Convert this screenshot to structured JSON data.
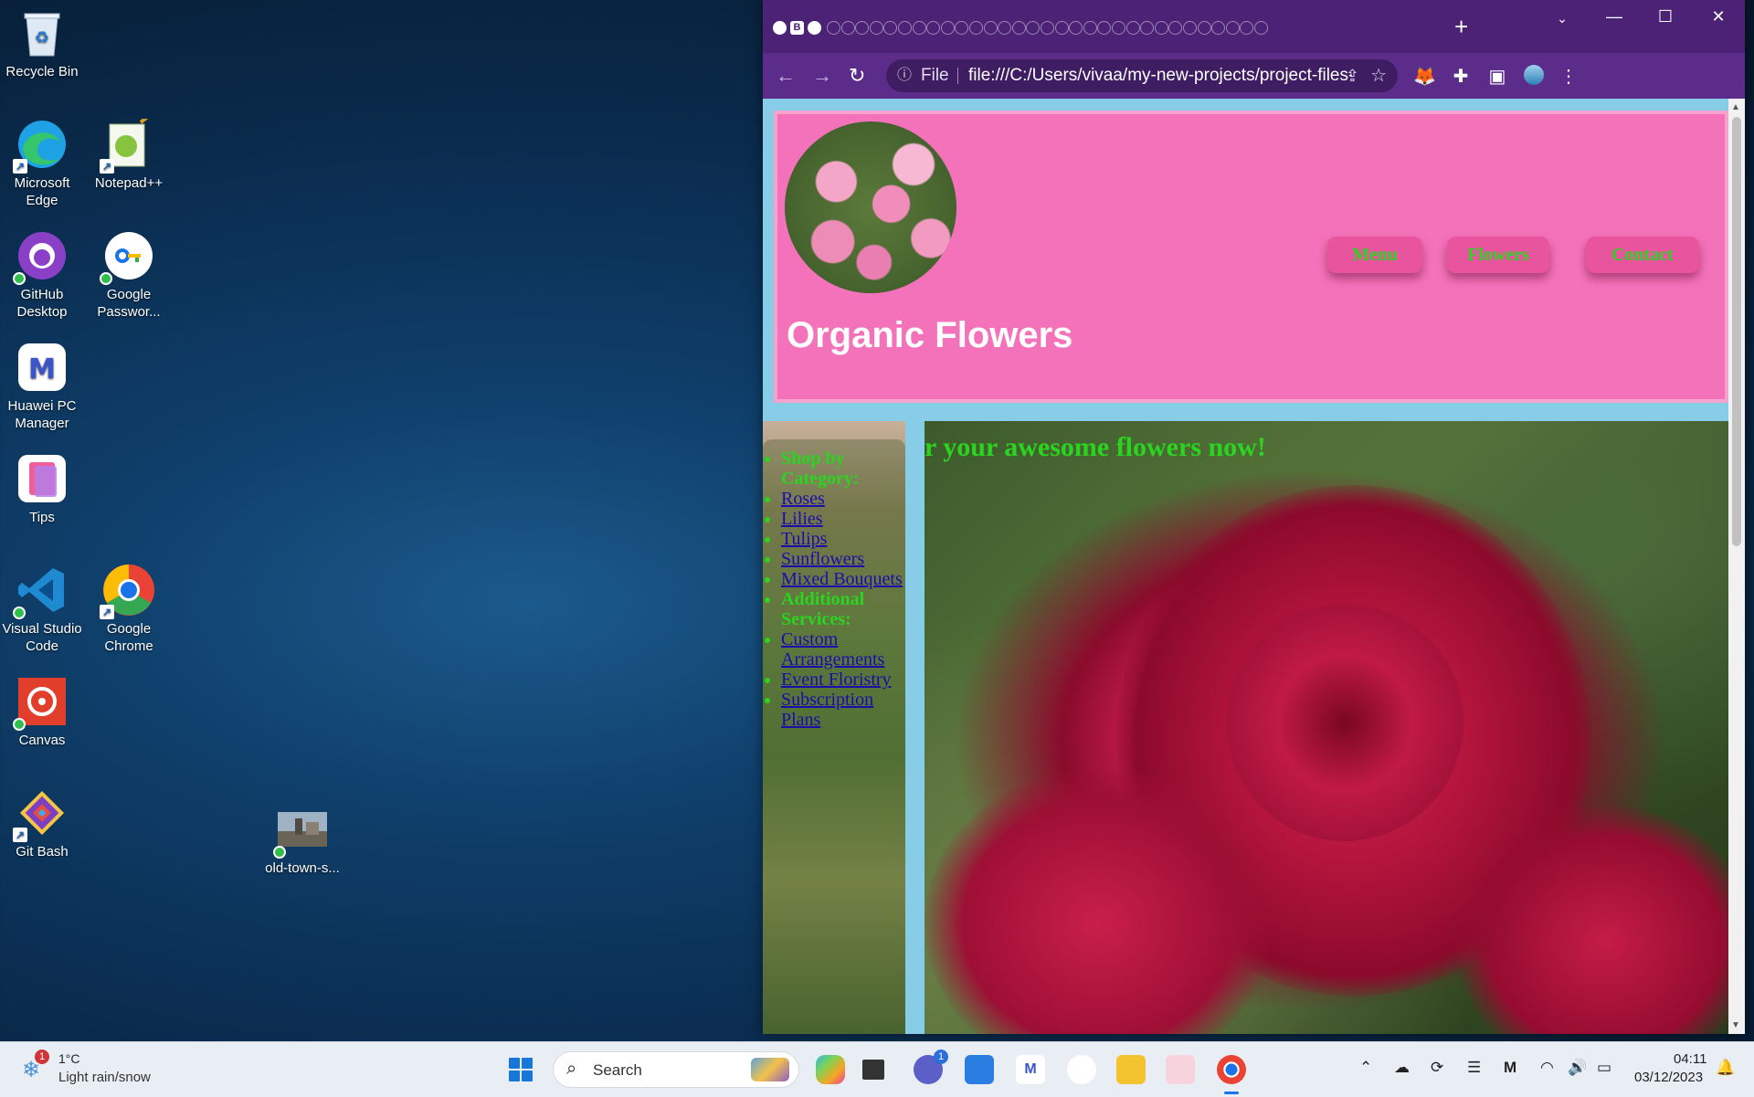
{
  "desktop": {
    "icons": [
      {
        "label": "Recycle Bin"
      },
      {
        "label": "Microsoft Edge"
      },
      {
        "label": "Notepad++"
      },
      {
        "label": "GitHub Desktop"
      },
      {
        "label": "Google Passwor..."
      },
      {
        "label": "Huawei PC Manager"
      },
      {
        "label": "Tips"
      },
      {
        "label": "Visual Studio Code"
      },
      {
        "label": "Google Chrome"
      },
      {
        "label": "Canvas"
      },
      {
        "label": "Git Bash"
      },
      {
        "label": "old-town-s..."
      }
    ]
  },
  "browser": {
    "omnibox": {
      "scheme": "File",
      "url": "file:///C:/Users/vivaa/my-new-projects/project-files-folder/html-files/f..."
    },
    "tabs": {
      "favicon_b": "B"
    },
    "newtab_label": "+"
  },
  "site": {
    "title": "Organic Flowers",
    "nav": [
      "Menu",
      "Flowers",
      "Contact"
    ],
    "sidebar": {
      "shop_header": "Shop by Category:",
      "categories": [
        "Roses",
        "Lilies",
        "Tulips",
        "Sunflowers",
        "Mixed Bouquets"
      ],
      "services_header": "Additional Services:",
      "services": [
        "Custom Arrangements",
        "Event Floristry",
        "Subscription Plans"
      ]
    },
    "hero_text": "r your awesome flowers now!"
  },
  "taskbar": {
    "weather": {
      "temp": "1°C",
      "desc": "Light rain/snow",
      "badge": "1"
    },
    "search_placeholder": "Search",
    "teams_badge": "1",
    "clock": {
      "time": "04:11",
      "date": "03/12/2023"
    }
  },
  "colors": {
    "browser_frame": "#4b2275",
    "site_header_bg": "#f472b9",
    "site_green_text": "#2ad41f",
    "page_bg": "#87cde8"
  }
}
